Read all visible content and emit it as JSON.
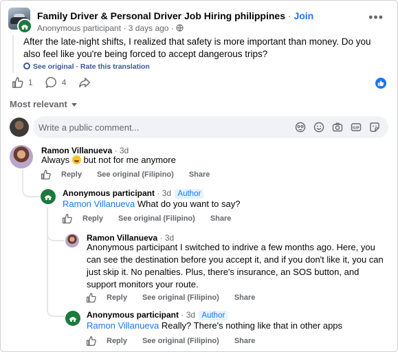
{
  "post": {
    "group_name": "Family Driver & Personal Driver Job Hiring philippines",
    "separator": "·",
    "join_label": "Join",
    "author": "Anonymous participant",
    "time": "3 days ago",
    "privacy_icon": "globe-icon",
    "text": "After the late-night shifts, I realized that safety is more important than money. Do you also feel like you're being forced to accept dangerous trips?",
    "see_original": "See original",
    "rate_translation": "Rate this translation",
    "like_count": "1",
    "comment_count": "4",
    "reaction": "like"
  },
  "sort": {
    "label": "Most relevant"
  },
  "composer": {
    "placeholder": "Write a public comment...",
    "icons": [
      "avatar-sticker-icon",
      "emoji-icon",
      "camera-icon",
      "gif-icon",
      "sticker-icon"
    ]
  },
  "comments": [
    {
      "name": "Ramon Villanueva",
      "time": "3d",
      "text_before": "Always",
      "emoji": "grinning-face",
      "text_after": "but not for me anymore",
      "actions": {
        "reply": "Reply",
        "see_original": "See original (Filipino)",
        "share": "Share"
      }
    },
    {
      "name": "Anonymous participant",
      "time": "3d",
      "badge": "Author",
      "mention": "Ramon Villanueva",
      "text": "What do you want to say?",
      "actions": {
        "reply": "Reply",
        "see_original": "See original (Filipino)",
        "share": "Share"
      }
    },
    {
      "name": "Ramon Villanueva",
      "time": "3d",
      "text": "Anonymous participant I switched to indrive a few months ago. Here, you can see the destination before you accept it, and if you don't like it, you can just skip it. No penalties. Plus, there's insurance, an SOS button, and support monitors your route.",
      "actions": {
        "reply": "Reply",
        "see_original": "See original (Filipino)",
        "share": "Share"
      }
    },
    {
      "name": "Anonymous participant",
      "time": "3d",
      "badge": "Author",
      "mention": "Ramon Villanueva",
      "text": "Really? There's nothing like that in other apps",
      "actions": {
        "reply": "Reply",
        "see_original": "See original (Filipino)",
        "share": "Share"
      }
    }
  ],
  "colors": {
    "link": "#1877f2",
    "muted": "#65676b",
    "anon_green": "#1b7a3d",
    "author_tag_bg": "#e7f3ff"
  }
}
